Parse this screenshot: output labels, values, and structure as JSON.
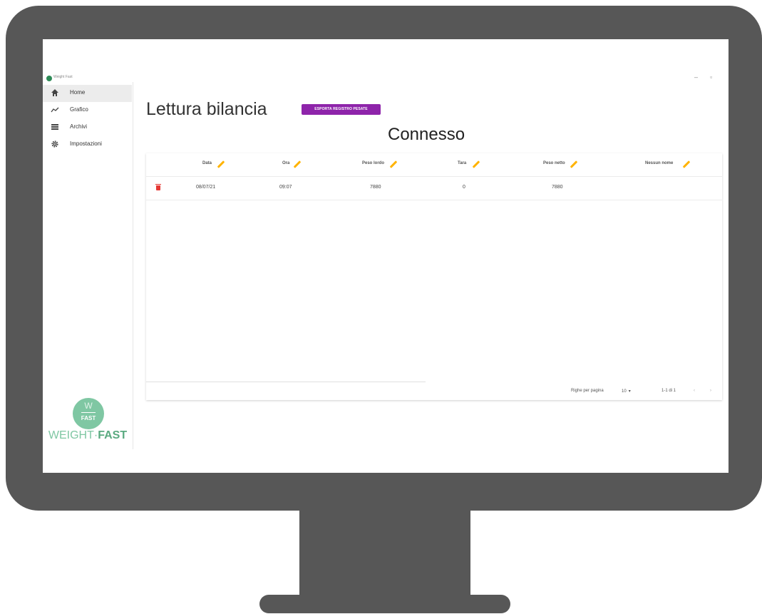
{
  "window": {
    "title": "Weight Fast",
    "minimize_glyph": "–",
    "restore_glyph": "▫"
  },
  "sidebar": {
    "items": [
      {
        "label": "Home",
        "icon": "home-icon",
        "active": true
      },
      {
        "label": "Grafico",
        "icon": "chart-line-icon",
        "active": false
      },
      {
        "label": "Archivi",
        "icon": "list-icon",
        "active": false
      },
      {
        "label": "Impostazioni",
        "icon": "gear-icon",
        "active": false
      }
    ],
    "brand": {
      "circle_top": "W",
      "circle_bottom": "FAST",
      "name_light": "WEIGHT·",
      "name_bold": "FAST"
    }
  },
  "main": {
    "title": "Lettura bilancia",
    "export_label": "ESPORTA REGISTRO PESATE",
    "status": "Connesso"
  },
  "table": {
    "columns": [
      "Data",
      "Ora",
      "Peso lordo",
      "Tara",
      "Peso netto",
      "Nessun nome"
    ],
    "rows": [
      {
        "data": "08/07/21",
        "ora": "09:07",
        "peso_lordo": "7880",
        "tara": "0",
        "peso_netto": "7880",
        "nessun_nome": ""
      }
    ],
    "pagination": {
      "rows_label": "Righe per pagina",
      "rows_value": "10",
      "range": "1-1 di 1"
    }
  },
  "colors": {
    "accent": "#8e24aa",
    "edit": "#ffb300",
    "delete": "#e53935",
    "brand": "#7fc7a3",
    "bezel": "#575757"
  }
}
